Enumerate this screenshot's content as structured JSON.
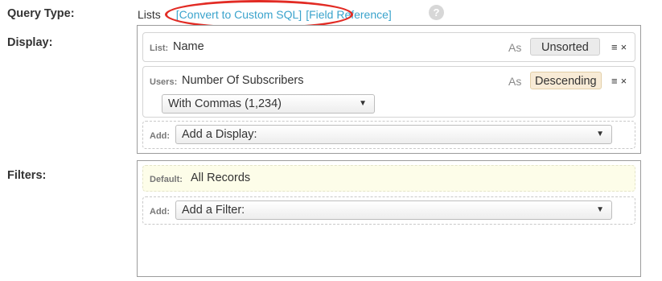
{
  "query_type": {
    "label": "Query Type:",
    "value": "Lists",
    "links": [
      "[Convert to Custom SQL]",
      "[Field Reference]"
    ],
    "help_icon": "?"
  },
  "display": {
    "label": "Display:",
    "rows": [
      {
        "prefix": "List:",
        "field": "Name",
        "as_label": "As",
        "sort": "Unsorted",
        "menu_icon": "≡",
        "remove_icon": "×"
      },
      {
        "prefix": "Users:",
        "field": "Number Of Subscribers",
        "as_label": "As",
        "sort": "Descending",
        "format": "With Commas (1,234)",
        "menu_icon": "≡",
        "remove_icon": "×"
      }
    ],
    "add_label": "Add:",
    "add_placeholder": "Add a Display:"
  },
  "filters": {
    "label": "Filters:",
    "default_label": "Default:",
    "default_value": "All Records",
    "add_label": "Add:",
    "add_placeholder": "Add a Filter:"
  },
  "icons": {
    "dropdown_arrow": "▼"
  },
  "colors": {
    "link": "#3aa3cc",
    "highlight": "#e22b24",
    "active_sort_bg": "#f8ebd6",
    "default_filter_bg": "#fdfde9"
  }
}
